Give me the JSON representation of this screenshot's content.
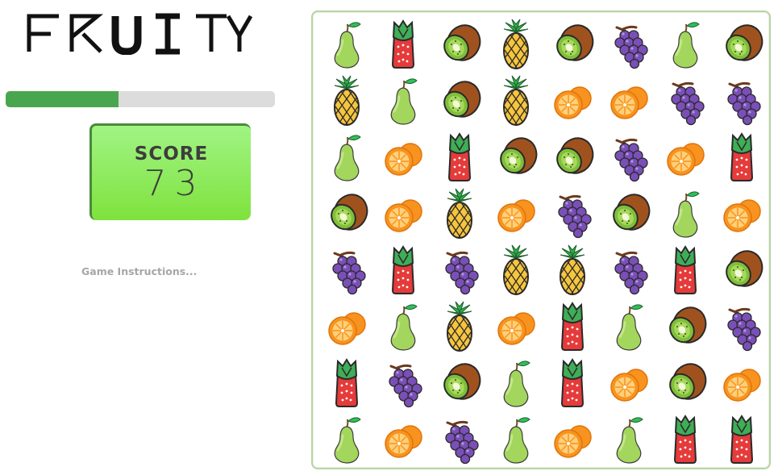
{
  "app": {
    "title": "FRUITY"
  },
  "progress": {
    "fraction": 0.42
  },
  "score": {
    "label": "SCORE",
    "value": "73"
  },
  "instructions": {
    "link_text": "Game Instructions..."
  },
  "colors": {
    "progress_fill": "#4aa64e",
    "progress_track": "#dcdcdc",
    "score_gradient_top": "#a0f484",
    "score_gradient_bottom": "#7fe23d",
    "board_border": "#b8d4a4"
  },
  "board": {
    "rows": 8,
    "cols": 8,
    "grid": [
      [
        "pear",
        "strawberry",
        "kiwi",
        "pineapple",
        "kiwi",
        "grapes",
        "pear",
        "kiwi"
      ],
      [
        "pineapple",
        "pear",
        "kiwi",
        "pineapple",
        "orange",
        "orange",
        "grapes",
        "grapes"
      ],
      [
        "pear",
        "orange",
        "strawberry",
        "kiwi",
        "kiwi",
        "grapes",
        "orange",
        "strawberry"
      ],
      [
        "kiwi",
        "orange",
        "pineapple",
        "orange",
        "grapes",
        "kiwi",
        "pear",
        "orange"
      ],
      [
        "grapes",
        "strawberry",
        "grapes",
        "pineapple",
        "pineapple",
        "grapes",
        "strawberry",
        "kiwi"
      ],
      [
        "orange",
        "pear",
        "pineapple",
        "orange",
        "strawberry",
        "pear",
        "kiwi",
        "grapes"
      ],
      [
        "strawberry",
        "grapes",
        "kiwi",
        "pear",
        "strawberry",
        "orange",
        "kiwi",
        "orange"
      ],
      [
        "pear",
        "orange",
        "grapes",
        "pear",
        "orange",
        "pear",
        "strawberry",
        "strawberry"
      ]
    ]
  }
}
